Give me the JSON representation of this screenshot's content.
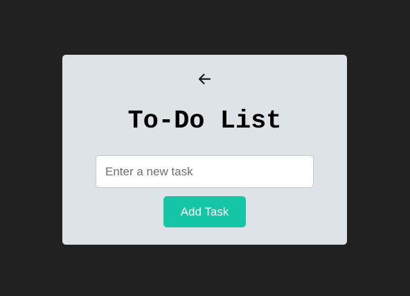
{
  "app": {
    "title": "To-Do List"
  },
  "nav": {
    "back_icon": "arrow-left-icon"
  },
  "form": {
    "input_value": "",
    "input_placeholder": "Enter a new task",
    "add_button_label": "Add Task"
  },
  "colors": {
    "page_background": "#212121",
    "card_background": "#dee3e7",
    "accent": "#14c5a6",
    "button_text": "#ffffff",
    "title_text": "#000000"
  }
}
